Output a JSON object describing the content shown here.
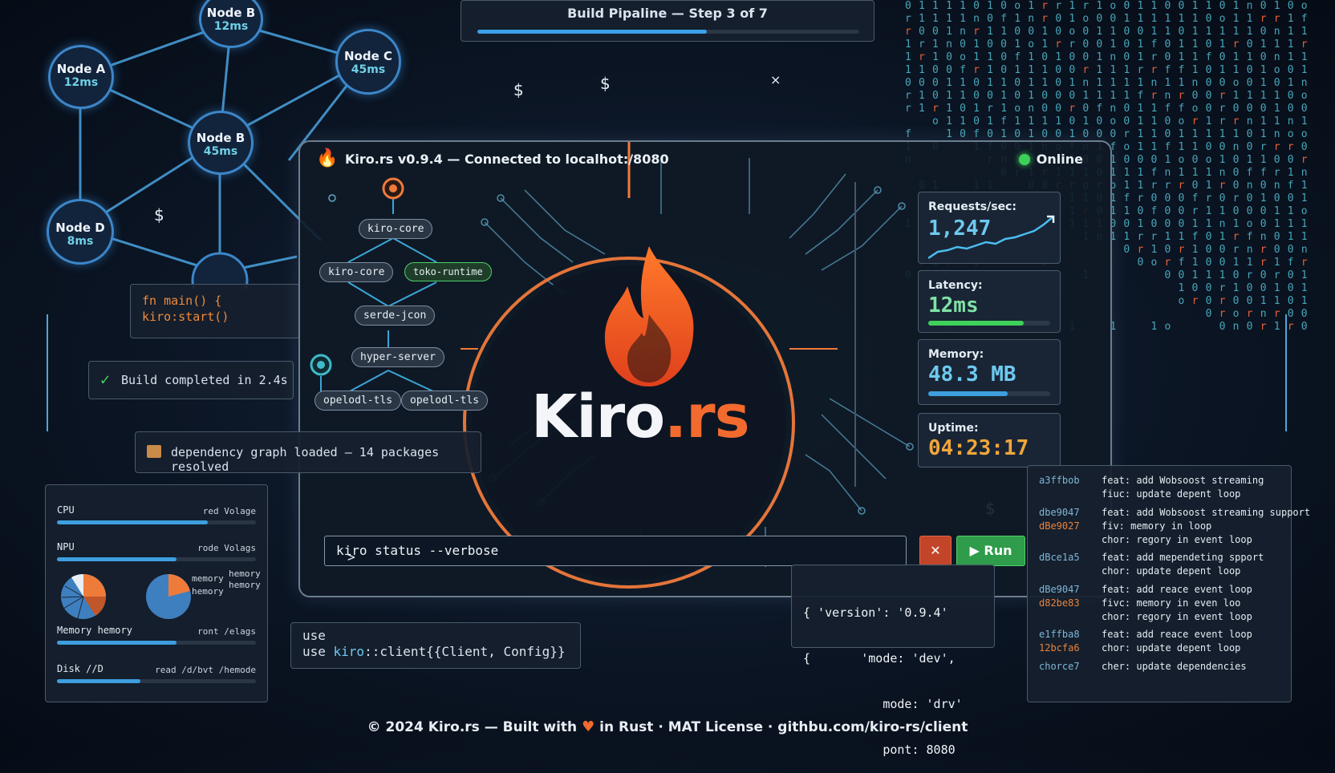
{
  "pipeline": {
    "title": "Build Pipaline — Step 3 of 7",
    "progress": 0.6
  },
  "network": {
    "nodes": [
      {
        "name": "Node B",
        "latency": "12ms"
      },
      {
        "name": "Node A",
        "latency": "12ms"
      },
      {
        "name": "Node C",
        "latency": "45ms"
      },
      {
        "name": "Node B",
        "latency": "45ms"
      },
      {
        "name": "Node D",
        "latency": "8ms"
      }
    ]
  },
  "code_main": {
    "line1": "fn main() {",
    "line2": "kiro:start()"
  },
  "build_status": {
    "text": "Build completed in 2.4s",
    "icon": "check-icon"
  },
  "dependency_banner": {
    "text": "dependency graph loaded — 14 packages resolved",
    "icon": "package-icon"
  },
  "window": {
    "title": "Kiro.rs v0.9.4 — Connected to localhot:/8080",
    "status": "Online",
    "status_color": "#3ed15a"
  },
  "dependency_tree": {
    "nodes": [
      "kiro-core",
      "kiro-core",
      "toko-runtime",
      "serde-jcon",
      "hyper-server",
      "opelodl-tls",
      "opelodl-tls"
    ]
  },
  "logo": {
    "part1": "Kiro",
    "part2": ".rs",
    "accent": "#f26a2e"
  },
  "metrics": {
    "requests": {
      "label": "Requests/sec:",
      "value": "1,247"
    },
    "latency": {
      "label": "Latency:",
      "value": "12ms",
      "fill": 0.78
    },
    "memory": {
      "label": "Memory:",
      "value": "48.3 MB",
      "fill": 0.65
    },
    "uptime": {
      "label": "Uptime:",
      "value": "04:23:17"
    }
  },
  "command": {
    "prompt": ">",
    "value": "kiro status --verbose",
    "run_label": "Run",
    "cancel_icon": "close-icon"
  },
  "json_output": {
    "lines": [
      "{ 'version': '0.9.4'",
      "{       'mode: 'dev',",
      "           mode: 'drv'",
      "           pont: 8080"
    ]
  },
  "use_snippet": {
    "line1": "use",
    "line2a": "use ",
    "line2b": "kiro",
    "line2c": "::client{{Client, Config}}"
  },
  "commits": [
    {
      "hashes": [
        "a3ffbob"
      ],
      "msgs": [
        "feat: add Wobsoost streaming",
        "fiuc: update depent loop"
      ]
    },
    {
      "hashes": [
        "dbe9047",
        "dBe9027"
      ],
      "msgs": [
        "feat: add Wobsoost streaming support",
        "fiv:  memory in loop",
        "chor: regory in event loop"
      ]
    },
    {
      "hashes": [
        "dBce1a5"
      ],
      "msgs": [
        "feat: add mependeting spport",
        "chor: update depent loop"
      ]
    },
    {
      "hashes": [
        "dBe9047",
        "d82be83"
      ],
      "msgs": [
        "feat: add reace event loop",
        "fivc: memory in even loo",
        "chor: regory in event loop"
      ]
    },
    {
      "hashes": [
        "e1ffba8",
        "12bcfa6"
      ],
      "msgs": [
        "feat: add reace event loop",
        "chor: update depent loop"
      ]
    },
    {
      "hashes": [
        "chorce7"
      ],
      "msgs": [
        "cher: update dependencies"
      ]
    }
  ],
  "system_monitor": {
    "cpu": {
      "label": "CPU",
      "right": "red Volage",
      "fill": 0.76
    },
    "npu": {
      "label": "NPU",
      "right": "rode Volags",
      "fill": 0.6
    },
    "pie_labels": {
      "a": "memory",
      "b": "hemory",
      "c": "hemory",
      "d": "hemory"
    },
    "memory": {
      "label": "Memory  hemory",
      "right": "ront /elags",
      "fill": 0.6
    },
    "disk": {
      "label": "Disk //D",
      "right": "read /d/bvt /hemode",
      "fill": 0.42
    }
  },
  "footer": {
    "pre": "© 2024 Kiro.rs — Built with",
    "post": "in Rust  ·  MAT License  ·  githbu.com/kiro-rs/client",
    "heart_color": "#f26a2e"
  }
}
